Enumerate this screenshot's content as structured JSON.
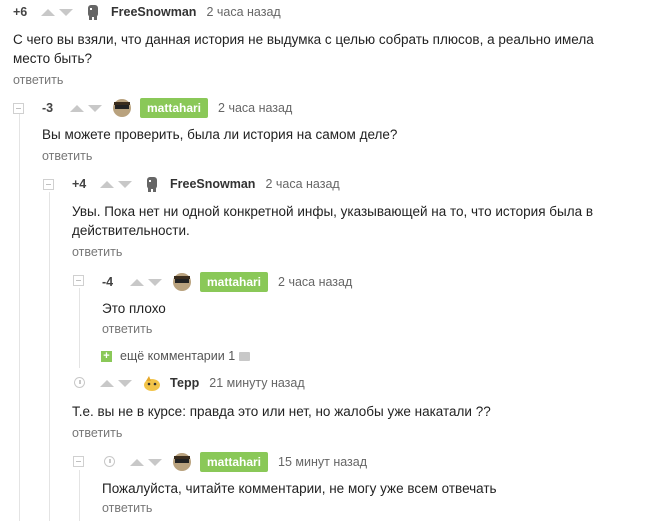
{
  "comments": [
    {
      "score": "+6",
      "user": "FreeSnowman",
      "time": "2 часа назад",
      "text": "С чего вы взяли, что данная история не выдумка с целью собрать плюсов, а реально имела место быть?",
      "reply": "ответить"
    },
    {
      "score": "-3",
      "user": "mattahari",
      "time": "2 часа назад",
      "text": "Вы можете проверить, была ли история на самом деле?",
      "reply": "ответить"
    },
    {
      "score": "+4",
      "user": "FreeSnowman",
      "time": "2 часа назад",
      "text": "Увы. Пока нет ни одной конкретной инфы, указывающей на то, что история была в действительности.",
      "reply": "ответить"
    },
    {
      "score": "-4",
      "user": "mattahari",
      "time": "2 часа назад",
      "text": "Это плохо",
      "reply": "ответить"
    },
    {
      "score": "",
      "user": "Терр",
      "time": "21 минуту назад",
      "text": "Т.е. вы не в курсе: правда это или нет, но жалобы уже накатали ??",
      "reply": "ответить"
    },
    {
      "score": "",
      "user": "mattahari",
      "time": "15 минут назад",
      "text": "Пожалуйста, читайте комментарии, не могу уже всем отвечать",
      "reply": "ответить"
    }
  ],
  "more_comments": {
    "label": "ещё комментарии",
    "count": "1"
  },
  "colors": {
    "accent_green": "#8ac858",
    "muted": "#c8c8c8"
  }
}
